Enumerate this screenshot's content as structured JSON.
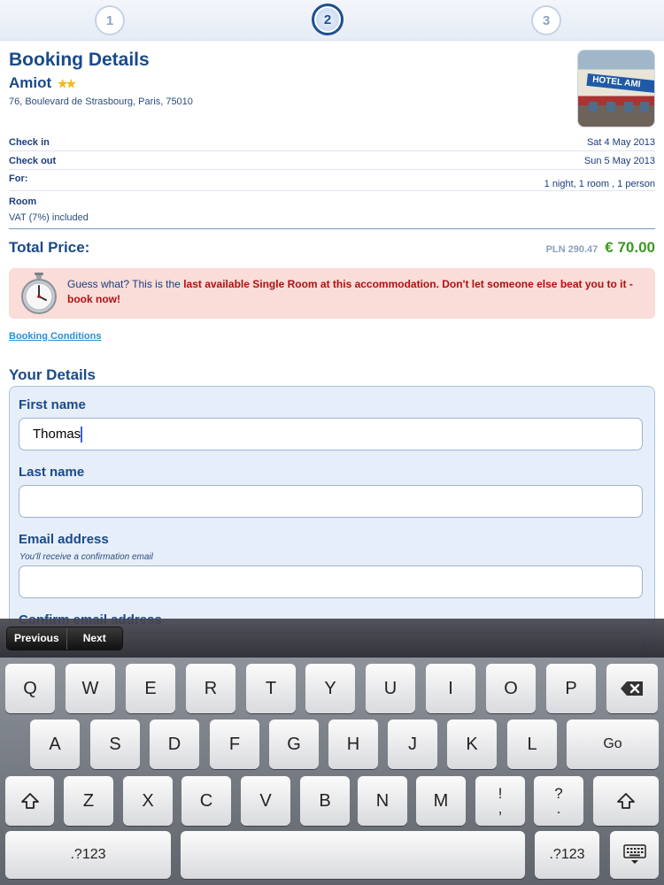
{
  "steps": [
    "1",
    "2",
    "3"
  ],
  "booking": {
    "title": "Booking Details",
    "hotel_name": "Amiot",
    "stars": "★★",
    "address": "76, Boulevard de Strasbourg, Paris, 75010",
    "photo_sign": "HOTEL AMI"
  },
  "details": {
    "check_in_label": "Check in",
    "check_in_value": "Sat 4 May 2013",
    "check_out_label": "Check out",
    "check_out_value": "Sun 5 May 2013",
    "for_label": "For:",
    "for_value": "1 night, 1 room , 1 person",
    "room_label": "Room",
    "vat": "VAT (7%) included"
  },
  "total": {
    "label": "Total Price:",
    "pln": "PLN 290.47",
    "eur": "€ 70.00"
  },
  "alert": {
    "prefix": "Guess what? This is the ",
    "bold": "last available Single Room at this accommodation. Don't let someone else beat you to it - book now!"
  },
  "conditions_link": "Booking Conditions",
  "form": {
    "section_title": "Your Details",
    "first_name_label": "First name",
    "first_name_value": "Thomas",
    "last_name_label": "Last name",
    "last_name_value": "",
    "email_label": "Email address",
    "email_hint": "You'll receive a confirmation email",
    "email_value": "",
    "confirm_email_label": "Confirm email address"
  },
  "keyboard": {
    "previous": "Previous",
    "next": "Next",
    "row1": [
      "Q",
      "W",
      "E",
      "R",
      "T",
      "Y",
      "U",
      "I",
      "O",
      "P"
    ],
    "row2": [
      "A",
      "S",
      "D",
      "F",
      "G",
      "H",
      "J",
      "K",
      "L"
    ],
    "row3": [
      "Z",
      "X",
      "C",
      "V",
      "B",
      "N",
      "M"
    ],
    "go": "Go",
    "numbers": ".?123",
    "excl_top": "!",
    "excl_bottom": ",",
    "quest_top": "?",
    "quest_bottom": "."
  }
}
